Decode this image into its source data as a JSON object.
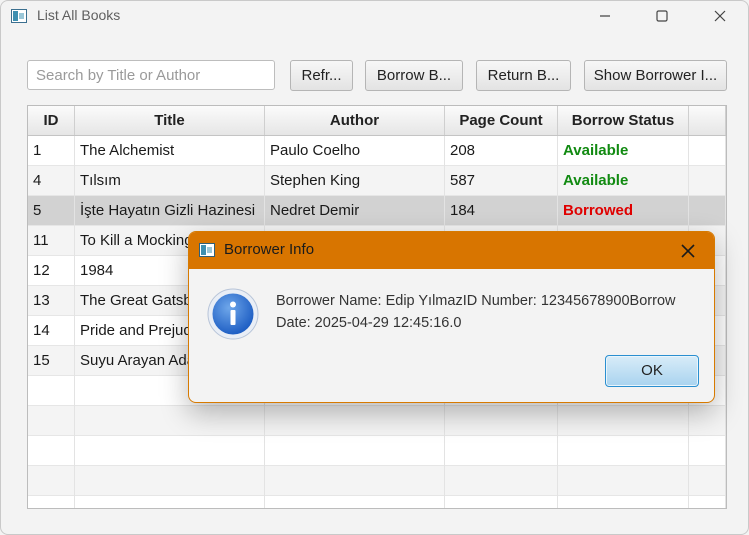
{
  "window": {
    "title": "List All Books",
    "controls": {
      "minimize_icon": "minimize-icon",
      "maximize_icon": "maximize-icon",
      "close_icon": "close-icon"
    }
  },
  "toolbar": {
    "search_placeholder": "Search by Title or Author",
    "search_value": "",
    "refresh_label": "Refr...",
    "borrow_label": "Borrow B...",
    "return_label": "Return B...",
    "show_borrower_label": "Show Borrower I..."
  },
  "table": {
    "columns": [
      "ID",
      "Title",
      "Author",
      "Page Count",
      "Borrow Status"
    ],
    "rows": [
      {
        "id": "1",
        "title": "The Alchemist",
        "author": "Paulo Coelho",
        "pages": "208",
        "status": "Available",
        "status_kind": "available"
      },
      {
        "id": "4",
        "title": "Tılsım",
        "author": "Stephen King",
        "pages": "587",
        "status": "Available",
        "status_kind": "available"
      },
      {
        "id": "5",
        "title": "İşte Hayatın Gizli Hazinesi",
        "author": "Nedret Demir",
        "pages": "184",
        "status": "Borrowed",
        "status_kind": "borrowed",
        "selected": true
      },
      {
        "id": "11",
        "title": "To Kill a Mocking",
        "author": "",
        "pages": "",
        "status": "",
        "status_kind": ""
      },
      {
        "id": "12",
        "title": "1984",
        "author": "",
        "pages": "",
        "status": "",
        "status_kind": ""
      },
      {
        "id": "13",
        "title": "The Great Gatsby",
        "author": "",
        "pages": "",
        "status": "",
        "status_kind": ""
      },
      {
        "id": "14",
        "title": "Pride and Prejud",
        "author": "",
        "pages": "",
        "status": "",
        "status_kind": ""
      },
      {
        "id": "15",
        "title": "Suyu Arayan Ada",
        "author": "",
        "pages": "",
        "status": "",
        "status_kind": ""
      }
    ],
    "empty_rows": 5
  },
  "dialog": {
    "title": "Borrower Info",
    "icon": "info-icon",
    "message_line1": "Borrower Name: Edip YılmazID Number: 12345678900Borrow",
    "message_line2": "Date: 2025-04-29 12:45:16.0",
    "ok_label": "OK"
  },
  "colors": {
    "available": "#118a11",
    "borrowed": "#e00000",
    "dialog_titlebar": "#d87500",
    "ok_button_border": "#2a8fd0"
  }
}
